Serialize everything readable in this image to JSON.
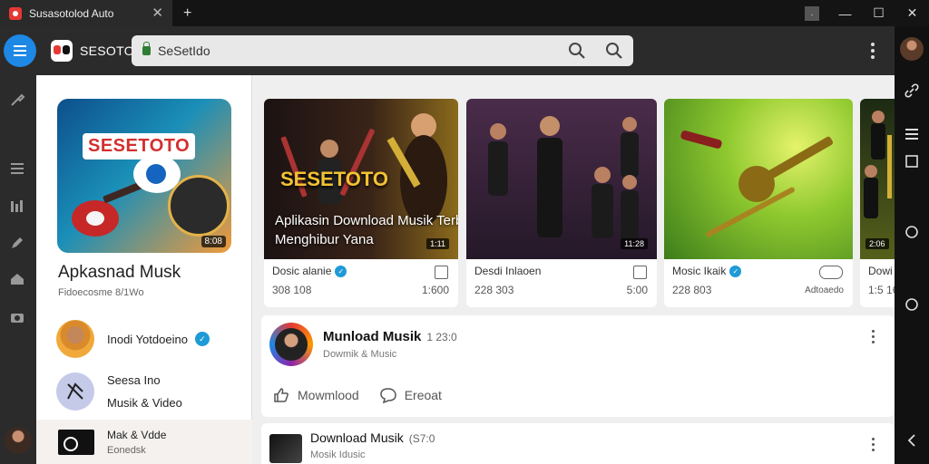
{
  "window": {
    "tab_title": "Susasotolod Auto",
    "tab_close": "✕",
    "new_tab": "+",
    "small_box": ".",
    "min": "—",
    "max": "☐",
    "close": "✕"
  },
  "toolbar": {
    "brand": "SESOTO",
    "address": "SeSetIdo"
  },
  "sidebar": {
    "hero_banner": "SESETOTO",
    "hero_duration": "8:08",
    "title": "Apkasnad Musk",
    "subtitle": "Fidoecosme 8/1Wo",
    "users": [
      {
        "name": "Inodi Yotdoeino"
      },
      {
        "name": "Seesa Ino",
        "sub": "Musik & Video"
      }
    ],
    "footer": {
      "title": "Mak & Vdde",
      "sub": "Eonedsk"
    }
  },
  "cards": [
    {
      "brand": "SESETOTO",
      "overlay": "Aplikasin Download Musik Terbaik putur Menghibur Yana",
      "duration": "1:11",
      "title": "Dosic alanie",
      "meta": "308 108",
      "count": "1:600"
    },
    {
      "duration": "11:28",
      "title": "Desdi Inlaoen",
      "meta": "228 303",
      "count": "5:00"
    },
    {
      "title": "Mosic Ikaik",
      "meta": "228 803",
      "count": "Adtoaedo"
    },
    {
      "duration": "2:06",
      "title": "Dowi",
      "meta": "1:5 16"
    }
  ],
  "feed": {
    "title": "Munload Musik",
    "count": "1 23:0",
    "sub": "Dowmik & Music",
    "actions": [
      {
        "label": "Mowmlood"
      },
      {
        "label": "Ereoat"
      }
    ]
  },
  "feed2": {
    "title": "Download Musik",
    "count": "(S7:0",
    "sub": "Mosik Idusic"
  }
}
